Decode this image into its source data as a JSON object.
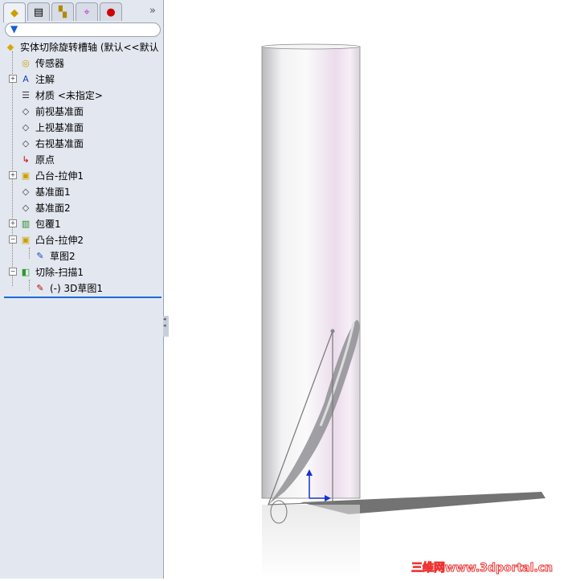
{
  "tabs": [
    {
      "icon": "feature-manager-icon"
    },
    {
      "icon": "property-manager-icon"
    },
    {
      "icon": "configuration-manager-icon"
    },
    {
      "icon": "dimxpert-icon"
    },
    {
      "icon": "display-manager-icon"
    }
  ],
  "more": "»",
  "filter_icon": "filter-icon",
  "tree": {
    "root": "实体切除旋转槽轴 (默认<<默认",
    "items": [
      {
        "label": "传感器",
        "icon": "sensor-icon"
      },
      {
        "label": "注解",
        "icon": "annotation-icon"
      },
      {
        "label": "材质 <未指定>",
        "icon": "material-icon"
      },
      {
        "label": "前视基准面",
        "icon": "plane-icon"
      },
      {
        "label": "上视基准面",
        "icon": "plane-icon"
      },
      {
        "label": "右视基准面",
        "icon": "plane-icon"
      },
      {
        "label": "原点",
        "icon": "origin-icon"
      },
      {
        "label": "凸台-拉伸1",
        "icon": "extrude-icon"
      },
      {
        "label": "基准面1",
        "icon": "plane-icon"
      },
      {
        "label": "基准面2",
        "icon": "plane-icon"
      },
      {
        "label": "包覆1",
        "icon": "wrap-icon"
      },
      {
        "label": "凸台-拉伸2",
        "icon": "extrude-icon"
      },
      {
        "label": "草图2",
        "icon": "sketch-icon"
      },
      {
        "label": "切除-扫描1",
        "icon": "cut-sweep-icon"
      },
      {
        "label": "(-) 3D草图1",
        "icon": "3d-sketch-icon"
      }
    ]
  },
  "watermark": "三维网www.3dportal.cn"
}
